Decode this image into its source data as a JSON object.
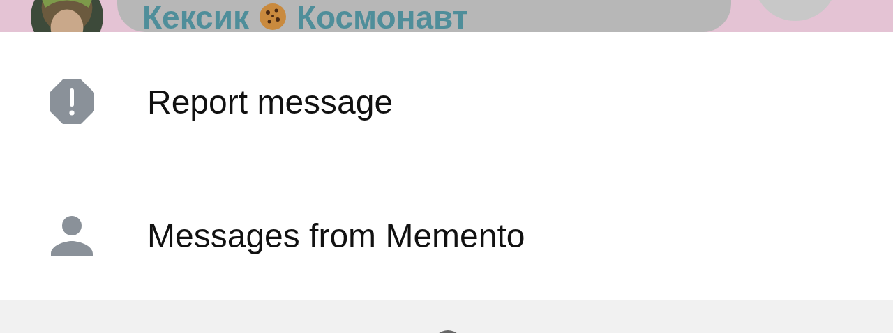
{
  "message_header": {
    "sender_name_start": "Кексик",
    "sender_name_end": "Космонавт"
  },
  "menu": {
    "items": [
      {
        "kind": "report",
        "label": "Report message"
      },
      {
        "kind": "person",
        "label": "Messages from Memento"
      }
    ]
  }
}
